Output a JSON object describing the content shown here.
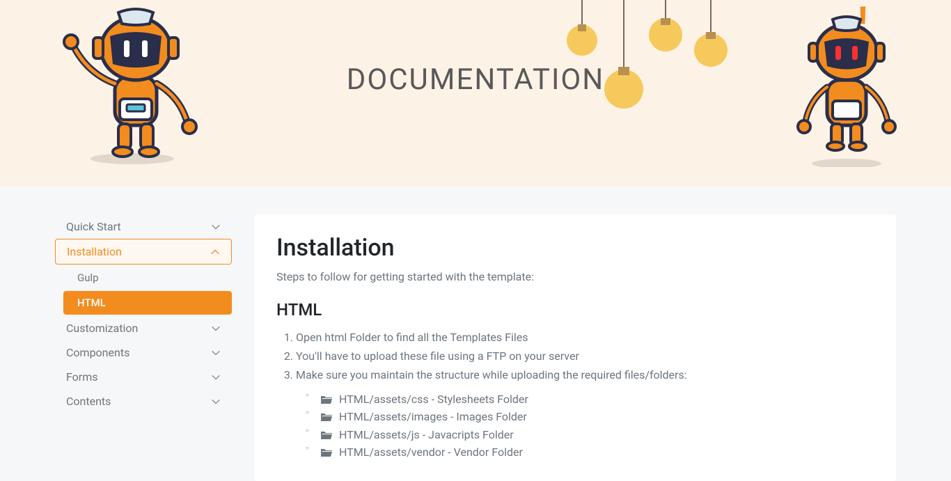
{
  "hero": {
    "title": "DOCUMENTATION"
  },
  "sidebar": {
    "items": [
      {
        "label": "Quick Start",
        "expanded": false,
        "active": false
      },
      {
        "label": "Installation",
        "expanded": true,
        "active": true,
        "subitems": [
          {
            "label": "Gulp",
            "selected": false
          },
          {
            "label": "HTML",
            "selected": true
          }
        ]
      },
      {
        "label": "Customization",
        "expanded": false,
        "active": false
      },
      {
        "label": "Components",
        "expanded": false,
        "active": false
      },
      {
        "label": "Forms",
        "expanded": false,
        "active": false
      },
      {
        "label": "Contents",
        "expanded": false,
        "active": false
      }
    ]
  },
  "content": {
    "heading": "Installation",
    "subtitle": "Steps to follow for getting started with the template:",
    "section_title": "HTML",
    "steps": [
      "Open html Folder to find all the Templates Files",
      "You'll have to upload these file using a FTP on your server",
      "Make sure you maintain the structure while uploading the required files/folders:"
    ],
    "folders": [
      "HTML/assets/css - Stylesheets Folder",
      "HTML/assets/images - Images Folder",
      "HTML/assets/js - Javacripts Folder",
      "HTML/assets/vendor - Vendor Folder"
    ]
  }
}
